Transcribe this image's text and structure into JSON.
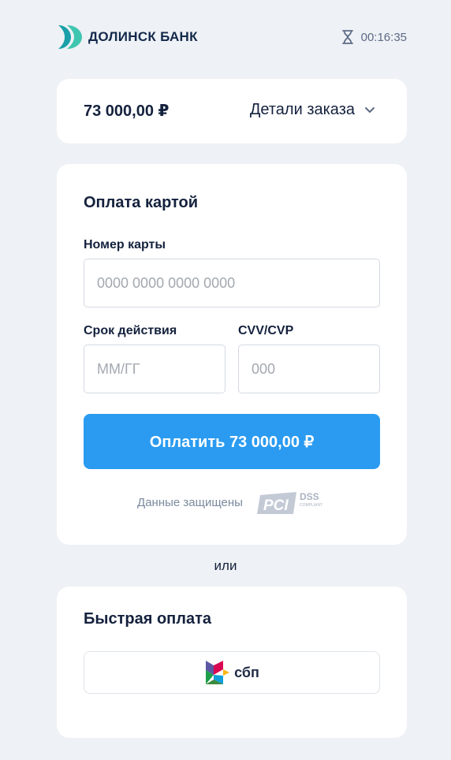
{
  "header": {
    "bank_name": "ДОЛИНСК БАНК",
    "timer": "00:16:35",
    "icons": {
      "logo": "bank-logo",
      "timer": "hourglass-icon"
    }
  },
  "order": {
    "amount": "73 000,00 ₽",
    "details_label": "Детали заказа",
    "details_icon": "chevron-down-icon"
  },
  "card_payment": {
    "title": "Оплата картой",
    "card_number": {
      "label": "Номер карты",
      "placeholder": "0000 0000 0000 0000",
      "value": ""
    },
    "expiry": {
      "label": "Срок действия",
      "placeholder": "ММ/ГГ",
      "value": ""
    },
    "cvv": {
      "label": "CVV/CVP",
      "placeholder": "000",
      "value": ""
    },
    "pay_button": "Оплатить 73 000,00 ₽",
    "secure_text": "Данные защищены",
    "pci_logo": {
      "main": "PCI",
      "sub": "DSS",
      "tag": "COMPLIANT"
    }
  },
  "separator": "или",
  "fast_payment": {
    "title": "Быстрая оплата",
    "sbp_label": "сбп"
  },
  "colors": {
    "background": "#eef1f5",
    "card": "#ffffff",
    "primary": "#2a9bf0",
    "text": "#14213d",
    "muted": "#7b8a9e",
    "logo_accent": "#3fc6b0"
  }
}
